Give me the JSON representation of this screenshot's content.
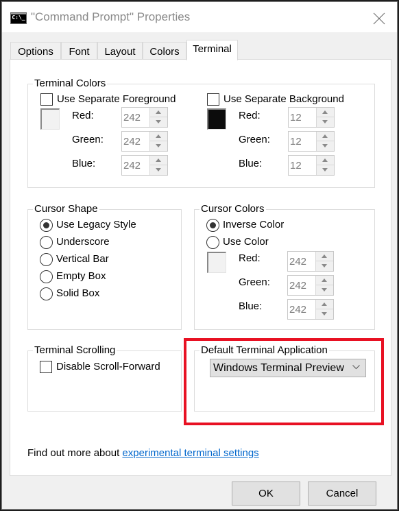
{
  "window": {
    "title": "\"Command Prompt\" Properties",
    "icon": "command-prompt-icon",
    "icon_text": "C:\\_"
  },
  "tabs": [
    {
      "label": "Options",
      "active": false
    },
    {
      "label": "Font",
      "active": false
    },
    {
      "label": "Layout",
      "active": false
    },
    {
      "label": "Colors",
      "active": false
    },
    {
      "label": "Terminal",
      "active": true
    }
  ],
  "terminal_colors": {
    "title": "Terminal Colors",
    "foreground": {
      "checkbox_label": "Use Separate Foreground",
      "checked": false,
      "swatch_color": "#f2f2f2",
      "red_label": "Red:",
      "red": "242",
      "green_label": "Green:",
      "green": "242",
      "blue_label": "Blue:",
      "blue": "242"
    },
    "background": {
      "checkbox_label": "Use Separate Background",
      "checked": false,
      "swatch_color": "#0c0c0c",
      "red_label": "Red:",
      "red": "12",
      "green_label": "Green:",
      "green": "12",
      "blue_label": "Blue:",
      "blue": "12"
    }
  },
  "cursor_shape": {
    "title": "Cursor Shape",
    "options": [
      {
        "label": "Use Legacy Style",
        "checked": true
      },
      {
        "label": "Underscore",
        "checked": false
      },
      {
        "label": "Vertical Bar",
        "checked": false
      },
      {
        "label": "Empty Box",
        "checked": false
      },
      {
        "label": "Solid Box",
        "checked": false
      }
    ]
  },
  "cursor_colors": {
    "title": "Cursor Colors",
    "options": [
      {
        "label": "Inverse Color",
        "checked": true
      },
      {
        "label": "Use Color",
        "checked": false
      }
    ],
    "swatch_color": "#f2f2f2",
    "red_label": "Red:",
    "red": "242",
    "green_label": "Green:",
    "green": "242",
    "blue_label": "Blue:",
    "blue": "242"
  },
  "terminal_scrolling": {
    "title": "Terminal Scrolling",
    "checkbox_label": "Disable Scroll-Forward",
    "checked": false
  },
  "default_terminal": {
    "title": "Default Terminal Application",
    "selected": "Windows Terminal Preview",
    "highlight_color": "#e81123"
  },
  "footer": {
    "prefix": "Find out more about ",
    "link_text": "experimental terminal settings"
  },
  "buttons": {
    "ok": "OK",
    "cancel": "Cancel"
  }
}
